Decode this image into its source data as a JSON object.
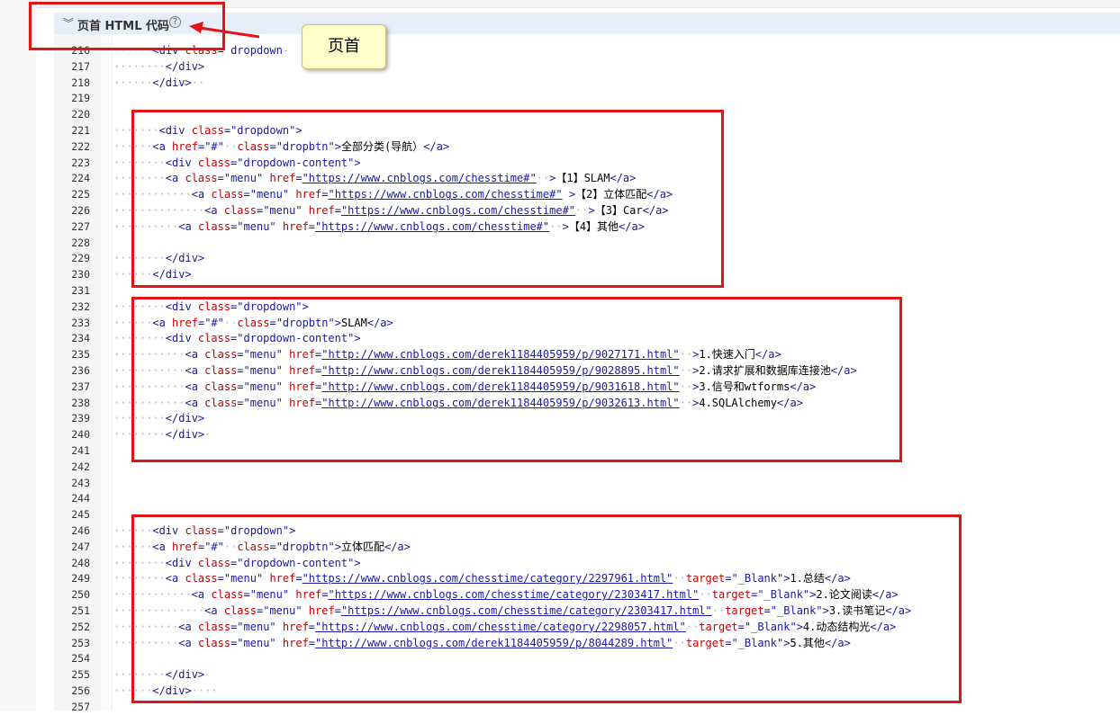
{
  "header": {
    "title": "页首 HTML 代码",
    "collapse_icon": "chevron-double-down-icon",
    "help_icon": "help-icon",
    "help_glyph": "?"
  },
  "callout": {
    "label": "页首"
  },
  "colors": {
    "annotation_red": "#e01515",
    "header_bg": "#e8eef7",
    "callout_bg": "#ffffcc"
  },
  "lines": [
    {
      "n": "216",
      "i": "······",
      "p": [
        [
          "tag",
          "<div "
        ],
        [
          "attr",
          "class"
        ],
        [
          "tag",
          "="
        ],
        [
          "ws",
          " "
        ],
        [
          "val",
          "dropdown"
        ],
        [
          "ws",
          "-"
        ]
      ]
    },
    {
      "n": "217",
      "i": "········",
      "p": [
        [
          "tag",
          "</div>"
        ]
      ]
    },
    {
      "n": "218",
      "i": "······",
      "p": [
        [
          "tag",
          "</div>"
        ],
        [
          "ws",
          "··"
        ]
      ]
    },
    {
      "n": "219",
      "i": "",
      "p": []
    },
    {
      "n": "220",
      "i": "",
      "p": []
    },
    {
      "n": "221",
      "i": "·······",
      "p": [
        [
          "tag",
          "<div "
        ],
        [
          "attr",
          "class"
        ],
        [
          "tag",
          "="
        ],
        [
          "val",
          "\"dropdown\""
        ],
        [
          "tag",
          ">"
        ]
      ]
    },
    {
      "n": "222",
      "i": "······",
      "p": [
        [
          "tag",
          "<a "
        ],
        [
          "attr",
          "href"
        ],
        [
          "tag",
          "="
        ],
        [
          "val",
          "\"#\""
        ],
        [
          "ws",
          "··"
        ],
        [
          "attr",
          "class"
        ],
        [
          "tag",
          "="
        ],
        [
          "val",
          "\"dropbtn\""
        ],
        [
          "tag",
          ">"
        ],
        [
          "txt",
          "全部分类(导航）"
        ],
        [
          "tag",
          "</a>"
        ]
      ]
    },
    {
      "n": "223",
      "i": "········",
      "p": [
        [
          "tag",
          "<div "
        ],
        [
          "attr",
          "class"
        ],
        [
          "tag",
          "="
        ],
        [
          "val",
          "\"dropdown-content\""
        ],
        [
          "tag",
          ">"
        ]
      ]
    },
    {
      "n": "224",
      "i": "········",
      "p": [
        [
          "tag",
          "<a "
        ],
        [
          "attr",
          "class"
        ],
        [
          "tag",
          "="
        ],
        [
          "val",
          "\"menu\""
        ],
        [
          "ws",
          " "
        ],
        [
          "attr",
          "href"
        ],
        [
          "tag",
          "="
        ],
        [
          "url",
          "\"https://www.cnblogs.com/chesstime#\""
        ],
        [
          "ws",
          "··"
        ],
        [
          "tag",
          ">"
        ],
        [
          "txt",
          "【1】SLAM"
        ],
        [
          "tag",
          "</a>"
        ]
      ]
    },
    {
      "n": "225",
      "i": "············",
      "p": [
        [
          "tag",
          "<a "
        ],
        [
          "attr",
          "class"
        ],
        [
          "tag",
          "="
        ],
        [
          "val",
          "\"menu\""
        ],
        [
          "ws",
          " "
        ],
        [
          "attr",
          "href"
        ],
        [
          "tag",
          "="
        ],
        [
          "url",
          "\"https://www.cnblogs.com/chesstime#\""
        ],
        [
          "ws",
          " "
        ],
        [
          "tag",
          ">"
        ],
        [
          "txt",
          "【2】立体匹配"
        ],
        [
          "tag",
          "</a>"
        ]
      ]
    },
    {
      "n": "226",
      "i": "··············",
      "p": [
        [
          "tag",
          "<a "
        ],
        [
          "attr",
          "class"
        ],
        [
          "tag",
          "="
        ],
        [
          "val",
          "\"menu\""
        ],
        [
          "ws",
          " "
        ],
        [
          "attr",
          "href"
        ],
        [
          "tag",
          "="
        ],
        [
          "url",
          "\"https://www.cnblogs.com/chesstime#\""
        ],
        [
          "ws",
          "··"
        ],
        [
          "tag",
          ">"
        ],
        [
          "txt",
          "【3】Car"
        ],
        [
          "tag",
          "</a>"
        ]
      ]
    },
    {
      "n": "227",
      "i": "··········",
      "p": [
        [
          "tag",
          "<a "
        ],
        [
          "attr",
          "class"
        ],
        [
          "tag",
          "="
        ],
        [
          "val",
          "\"menu\""
        ],
        [
          "ws",
          " "
        ],
        [
          "attr",
          "href"
        ],
        [
          "tag",
          "="
        ],
        [
          "url",
          "\"https://www.cnblogs.com/chesstime#\""
        ],
        [
          "ws",
          "··"
        ],
        [
          "tag",
          ">"
        ],
        [
          "txt",
          "【4】其他"
        ],
        [
          "tag",
          "</a>"
        ]
      ]
    },
    {
      "n": "228",
      "i": "",
      "p": []
    },
    {
      "n": "229",
      "i": "········",
      "p": [
        [
          "tag",
          "</div>"
        ]
      ]
    },
    {
      "n": "230",
      "i": "······",
      "p": [
        [
          "tag",
          "</div>"
        ]
      ]
    },
    {
      "n": "231",
      "i": "",
      "p": []
    },
    {
      "n": "232",
      "i": "········",
      "p": [
        [
          "tag",
          "<div "
        ],
        [
          "attr",
          "class"
        ],
        [
          "tag",
          "="
        ],
        [
          "val",
          "\"dropdown\""
        ],
        [
          "tag",
          ">"
        ]
      ]
    },
    {
      "n": "233",
      "i": "······",
      "p": [
        [
          "tag",
          "<a "
        ],
        [
          "attr",
          "href"
        ],
        [
          "tag",
          "="
        ],
        [
          "val",
          "\"#\""
        ],
        [
          "ws",
          "··"
        ],
        [
          "attr",
          "class"
        ],
        [
          "tag",
          "="
        ],
        [
          "val",
          "\"dropbtn\""
        ],
        [
          "tag",
          ">"
        ],
        [
          "txt",
          "SLAM"
        ],
        [
          "tag",
          "</a>"
        ]
      ]
    },
    {
      "n": "234",
      "i": "········",
      "p": [
        [
          "tag",
          "<div "
        ],
        [
          "attr",
          "class"
        ],
        [
          "tag",
          "="
        ],
        [
          "val",
          "\"dropdown-content\""
        ],
        [
          "tag",
          ">"
        ]
      ]
    },
    {
      "n": "235",
      "i": "···········",
      "p": [
        [
          "tag",
          "<a "
        ],
        [
          "attr",
          "class"
        ],
        [
          "tag",
          "="
        ],
        [
          "val",
          "\"menu\""
        ],
        [
          "ws",
          " "
        ],
        [
          "attr",
          "href"
        ],
        [
          "tag",
          "="
        ],
        [
          "url",
          "\"http://www.cnblogs.com/derek1184405959/p/9027171.html\""
        ],
        [
          "ws",
          "··"
        ],
        [
          "tag",
          ">"
        ],
        [
          "txt",
          "1.快速入门"
        ],
        [
          "tag",
          "</a>"
        ]
      ]
    },
    {
      "n": "236",
      "i": "···········",
      "p": [
        [
          "tag",
          "<a "
        ],
        [
          "attr",
          "class"
        ],
        [
          "tag",
          "="
        ],
        [
          "val",
          "\"menu\""
        ],
        [
          "ws",
          " "
        ],
        [
          "attr",
          "href"
        ],
        [
          "tag",
          "="
        ],
        [
          "url",
          "\"http://www.cnblogs.com/derek1184405959/p/9028895.html\""
        ],
        [
          "ws",
          "··"
        ],
        [
          "tag",
          ">"
        ],
        [
          "txt",
          "2.请求扩展和数据库连接池"
        ],
        [
          "tag",
          "</a>"
        ]
      ]
    },
    {
      "n": "237",
      "i": "···········",
      "p": [
        [
          "tag",
          "<a "
        ],
        [
          "attr",
          "class"
        ],
        [
          "tag",
          "="
        ],
        [
          "val",
          "\"menu\""
        ],
        [
          "ws",
          " "
        ],
        [
          "attr",
          "href"
        ],
        [
          "tag",
          "="
        ],
        [
          "url",
          "\"http://www.cnblogs.com/derek1184405959/p/9031618.html\""
        ],
        [
          "ws",
          "··"
        ],
        [
          "tag",
          ">"
        ],
        [
          "txt",
          "3.信号和wtforms"
        ],
        [
          "tag",
          "</a>"
        ]
      ]
    },
    {
      "n": "238",
      "i": "···········",
      "p": [
        [
          "tag",
          "<a "
        ],
        [
          "attr",
          "class"
        ],
        [
          "tag",
          "="
        ],
        [
          "val",
          "\"menu\""
        ],
        [
          "ws",
          " "
        ],
        [
          "attr",
          "href"
        ],
        [
          "tag",
          "="
        ],
        [
          "url",
          "\"http://www.cnblogs.com/derek1184405959/p/9032613.html\""
        ],
        [
          "ws",
          "··"
        ],
        [
          "tag",
          ">"
        ],
        [
          "txt",
          "4.SQLAlchemy"
        ],
        [
          "tag",
          "</a>"
        ]
      ]
    },
    {
      "n": "239",
      "i": "········",
      "p": [
        [
          "tag",
          "</div>"
        ]
      ]
    },
    {
      "n": "240",
      "i": "········",
      "p": [
        [
          "tag",
          "</div>"
        ],
        [
          "ws",
          "·"
        ]
      ]
    },
    {
      "n": "241",
      "i": "",
      "p": []
    },
    {
      "n": "242",
      "i": "",
      "p": []
    },
    {
      "n": "243",
      "i": "",
      "p": []
    },
    {
      "n": "244",
      "i": "",
      "p": []
    },
    {
      "n": "245",
      "i": "",
      "p": []
    },
    {
      "n": "246",
      "i": "······",
      "p": [
        [
          "tag",
          "<div "
        ],
        [
          "attr",
          "class"
        ],
        [
          "tag",
          "="
        ],
        [
          "val",
          "\"dropdown\""
        ],
        [
          "tag",
          ">"
        ]
      ]
    },
    {
      "n": "247",
      "i": "······",
      "p": [
        [
          "tag",
          "<a "
        ],
        [
          "attr",
          "href"
        ],
        [
          "tag",
          "="
        ],
        [
          "val",
          "\"#\""
        ],
        [
          "ws",
          "··"
        ],
        [
          "attr",
          "class"
        ],
        [
          "tag",
          "="
        ],
        [
          "val",
          "\"dropbtn\""
        ],
        [
          "tag",
          ">"
        ],
        [
          "txt",
          "立体匹配"
        ],
        [
          "tag",
          "</a>"
        ]
      ]
    },
    {
      "n": "248",
      "i": "········",
      "p": [
        [
          "tag",
          "<div "
        ],
        [
          "attr",
          "class"
        ],
        [
          "tag",
          "="
        ],
        [
          "val",
          "\"dropdown-content\""
        ],
        [
          "tag",
          ">"
        ]
      ]
    },
    {
      "n": "249",
      "i": "········",
      "p": [
        [
          "tag",
          "<a "
        ],
        [
          "attr",
          "class"
        ],
        [
          "tag",
          "="
        ],
        [
          "val",
          "\"menu\""
        ],
        [
          "ws",
          " "
        ],
        [
          "attr",
          "href"
        ],
        [
          "tag",
          "="
        ],
        [
          "url",
          "\"https://www.cnblogs.com/chesstime/category/2297961.html\""
        ],
        [
          "ws",
          "··"
        ],
        [
          "attr",
          "target"
        ],
        [
          "tag",
          "="
        ],
        [
          "val",
          "\"_Blank\""
        ],
        [
          "tag",
          ">"
        ],
        [
          "txt",
          "1.总结"
        ],
        [
          "tag",
          "</a>"
        ]
      ]
    },
    {
      "n": "250",
      "i": "············",
      "p": [
        [
          "tag",
          "<a "
        ],
        [
          "attr",
          "class"
        ],
        [
          "tag",
          "="
        ],
        [
          "val",
          "\"menu\""
        ],
        [
          "ws",
          " "
        ],
        [
          "attr",
          "href"
        ],
        [
          "tag",
          "="
        ],
        [
          "url",
          "\"https://www.cnblogs.com/chesstime/category/2303417.html\""
        ],
        [
          "ws",
          "··"
        ],
        [
          "attr",
          "target"
        ],
        [
          "tag",
          "="
        ],
        [
          "val",
          "\"_Blank\""
        ],
        [
          "tag",
          ">"
        ],
        [
          "txt",
          "2.论文阅读"
        ],
        [
          "tag",
          "</a>"
        ]
      ]
    },
    {
      "n": "251",
      "i": "··············",
      "p": [
        [
          "tag",
          "<a "
        ],
        [
          "attr",
          "class"
        ],
        [
          "tag",
          "="
        ],
        [
          "val",
          "\"menu\""
        ],
        [
          "ws",
          " "
        ],
        [
          "attr",
          "href"
        ],
        [
          "tag",
          "="
        ],
        [
          "url",
          "\"https://www.cnblogs.com/chesstime/category/2303417.html\""
        ],
        [
          "ws",
          "··"
        ],
        [
          "attr",
          "target"
        ],
        [
          "tag",
          "="
        ],
        [
          "val",
          "\"_Blank\""
        ],
        [
          "tag",
          ">"
        ],
        [
          "txt",
          "3.读书笔记"
        ],
        [
          "tag",
          "</a>"
        ]
      ]
    },
    {
      "n": "252",
      "i": "··········",
      "p": [
        [
          "tag",
          "<a "
        ],
        [
          "attr",
          "class"
        ],
        [
          "tag",
          "="
        ],
        [
          "val",
          "\"menu\""
        ],
        [
          "ws",
          " "
        ],
        [
          "attr",
          "href"
        ],
        [
          "tag",
          "="
        ],
        [
          "url",
          "\"https://www.cnblogs.com/chesstime/category/2298057.html\""
        ],
        [
          "ws",
          "··"
        ],
        [
          "attr",
          "target"
        ],
        [
          "tag",
          "="
        ],
        [
          "val",
          "\"_Blank\""
        ],
        [
          "tag",
          ">"
        ],
        [
          "txt",
          "4.动态结构光"
        ],
        [
          "tag",
          "</a>"
        ]
      ]
    },
    {
      "n": "253",
      "i": "··········",
      "p": [
        [
          "tag",
          "<a "
        ],
        [
          "attr",
          "class"
        ],
        [
          "tag",
          "="
        ],
        [
          "val",
          "\"menu\""
        ],
        [
          "ws",
          " "
        ],
        [
          "attr",
          "href"
        ],
        [
          "tag",
          "="
        ],
        [
          "url",
          "\"http://www.cnblogs.com/derek1184405959/p/8044289.html\""
        ],
        [
          "ws",
          "··"
        ],
        [
          "attr",
          "target"
        ],
        [
          "tag",
          "="
        ],
        [
          "val",
          "\"_Blank\""
        ],
        [
          "tag",
          ">"
        ],
        [
          "txt",
          "5.其他"
        ],
        [
          "tag",
          "</a>"
        ]
      ]
    },
    {
      "n": "254",
      "i": "",
      "p": []
    },
    {
      "n": "255",
      "i": "········",
      "p": [
        [
          "tag",
          "</div>"
        ]
      ]
    },
    {
      "n": "256",
      "i": "······",
      "p": [
        [
          "tag",
          "</div>"
        ],
        [
          "ws",
          "····"
        ]
      ]
    },
    {
      "n": "257",
      "i": "",
      "p": []
    }
  ]
}
